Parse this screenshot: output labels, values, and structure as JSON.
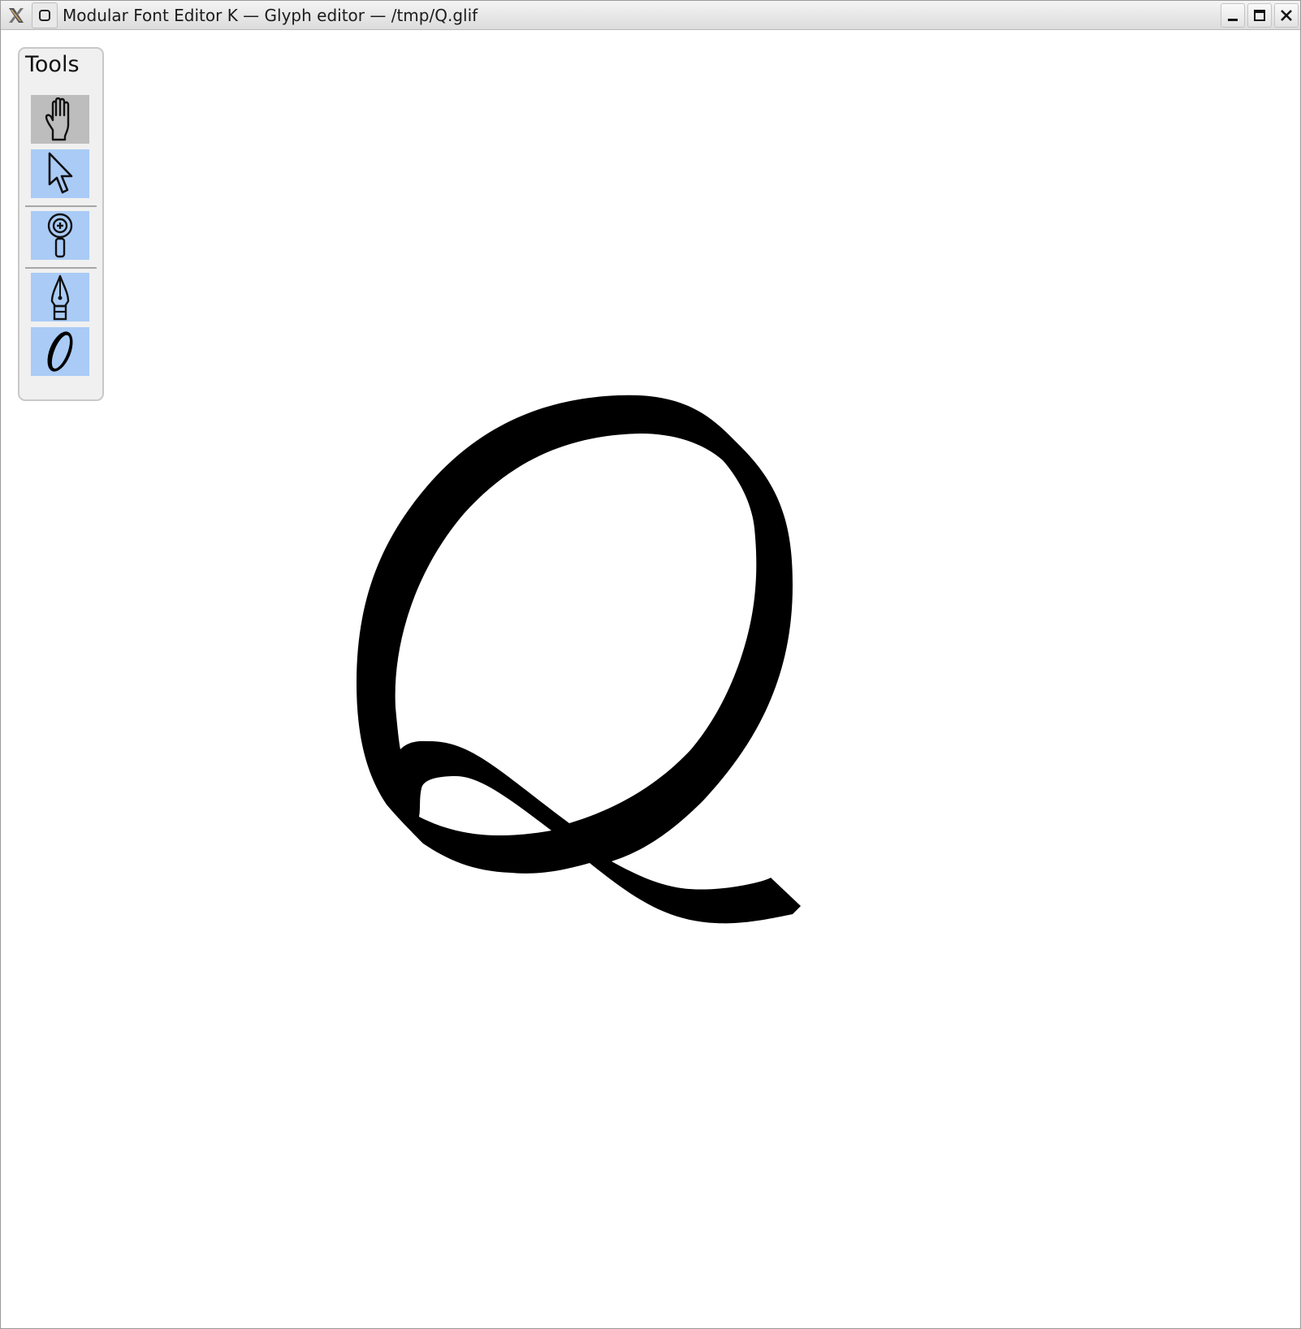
{
  "window": {
    "title": "Modular Font Editor K — Glyph editor — /tmp/Q.glif",
    "icons": [
      "x-logo-icon",
      "app-window-icon"
    ],
    "controls": [
      "minimize-icon",
      "maximize-icon",
      "close-icon"
    ]
  },
  "palette": {
    "title": "Tools",
    "active_tool": "pan",
    "tools": [
      {
        "id": "pan",
        "icon": "hand-icon"
      },
      {
        "id": "select",
        "icon": "pointer-arrow-icon"
      },
      {
        "id": "zoom",
        "icon": "magnifier-icon"
      },
      {
        "id": "pen",
        "icon": "pen-nib-icon"
      },
      {
        "id": "ellipse",
        "icon": "ellipse-icon"
      }
    ]
  },
  "colors": {
    "tool_background": "#a9cbf6",
    "tool_active_background": "#bdbdbd",
    "glyph_fill": "#000000",
    "canvas_background": "#ffffff"
  },
  "glyph": {
    "name": "Q",
    "filled": true
  }
}
